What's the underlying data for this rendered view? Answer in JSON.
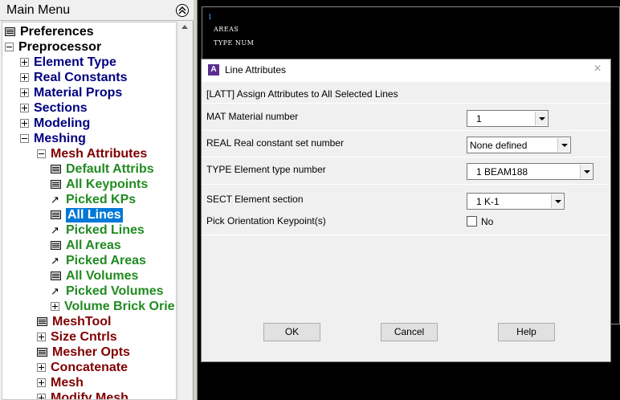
{
  "main_menu": {
    "title": "Main Menu",
    "items": [
      {
        "label": "Preferences",
        "kind": "fn",
        "color": "#000000",
        "level": 0
      },
      {
        "label": "Preprocessor",
        "kind": "minus",
        "color": "#000000",
        "level": 0
      },
      {
        "label": "Element Type",
        "kind": "plus",
        "color": "#000080",
        "level": 1
      },
      {
        "label": "Real Constants",
        "kind": "plus",
        "color": "#000080",
        "level": 1
      },
      {
        "label": "Material Props",
        "kind": "plus",
        "color": "#000080",
        "level": 1
      },
      {
        "label": "Sections",
        "kind": "plus",
        "color": "#000080",
        "level": 1
      },
      {
        "label": "Modeling",
        "kind": "plus",
        "color": "#000080",
        "level": 1
      },
      {
        "label": "Meshing",
        "kind": "minus",
        "color": "#000080",
        "level": 1
      },
      {
        "label": "Mesh Attributes",
        "kind": "minus",
        "color": "#800000",
        "level": 2
      },
      {
        "label": "Default Attribs",
        "kind": "fn",
        "color": "#218b21",
        "level": 3
      },
      {
        "label": "All Keypoints",
        "kind": "fn",
        "color": "#218b21",
        "level": 3
      },
      {
        "label": "Picked KPs",
        "kind": "pick",
        "color": "#218b21",
        "level": 3
      },
      {
        "label": "All Lines",
        "kind": "fn",
        "color": "#218b21",
        "level": 3,
        "selected": true
      },
      {
        "label": "Picked Lines",
        "kind": "pick",
        "color": "#218b21",
        "level": 3
      },
      {
        "label": "All Areas",
        "kind": "fn",
        "color": "#218b21",
        "level": 3
      },
      {
        "label": "Picked Areas",
        "kind": "pick",
        "color": "#218b21",
        "level": 3
      },
      {
        "label": "All Volumes",
        "kind": "fn",
        "color": "#218b21",
        "level": 3
      },
      {
        "label": "Picked Volumes",
        "kind": "pick",
        "color": "#218b21",
        "level": 3
      },
      {
        "label": "Volume Brick Orie",
        "kind": "plus",
        "color": "#218b21",
        "level": 3
      },
      {
        "label": "MeshTool",
        "kind": "fn",
        "color": "#800000",
        "level": 2
      },
      {
        "label": "Size Cntrls",
        "kind": "plus",
        "color": "#800000",
        "level": 2
      },
      {
        "label": "Mesher Opts",
        "kind": "fn",
        "color": "#800000",
        "level": 2
      },
      {
        "label": "Concatenate",
        "kind": "plus",
        "color": "#800000",
        "level": 2
      },
      {
        "label": "Mesh",
        "kind": "plus",
        "color": "#800000",
        "level": 2
      },
      {
        "label": "Modify Mesh",
        "kind": "plus",
        "color": "#800000",
        "level": 2
      }
    ]
  },
  "graphics": {
    "window_number": "1",
    "line1": "AREAS",
    "line2": "TYPE NUM"
  },
  "dialog": {
    "title": "Line Attributes",
    "app_icon": "A",
    "header": "[LATT]  Assign Attributes to All Selected Lines",
    "mat_label": "MAT   Material number",
    "mat_value": "1",
    "real_label": "REAL   Real constant set number",
    "real_value": "None defined",
    "type_label": "TYPE  Element type number",
    "type_value": "1    BEAM188",
    "sect_label": "SECT  Element section",
    "sect_value": "1    K-1",
    "pick_label": "Pick Orientation Keypoint(s)",
    "pick_checked": false,
    "pick_value": "No",
    "ok_label": "OK",
    "cancel_label": "Cancel",
    "help_label": "Help"
  }
}
